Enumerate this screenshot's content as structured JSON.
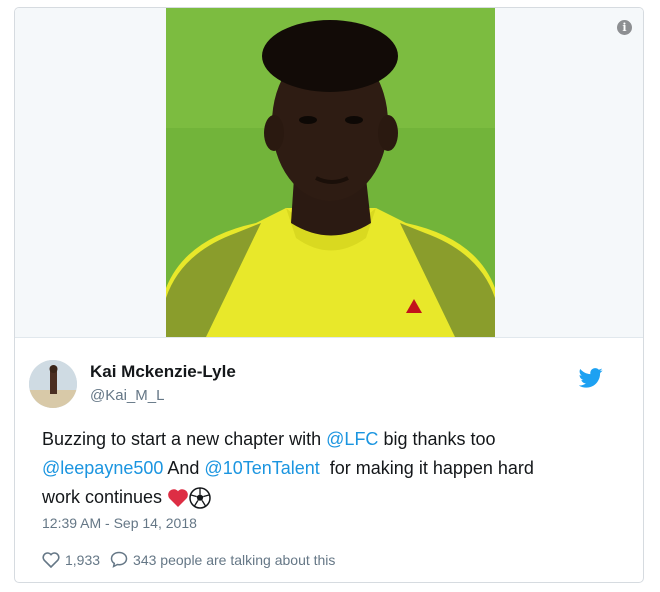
{
  "media": {
    "info_icon": "i",
    "icon": "info-icon"
  },
  "author": {
    "name": "Kai Mckenzie-Lyle",
    "handle": "@Kai_M_L",
    "brand_icon": "twitter-bird-icon",
    "brand_color": "#1da1f2"
  },
  "tweet": {
    "part1": "Buzzing to start a new chapter with ",
    "mention1": "@LFC",
    "part2": " big thanks too",
    "mention2": "@leepayne500",
    "part3": " And ",
    "mention3": "@10TenTalent",
    "part4": "  for making it happen hard",
    "part5": "work continues",
    "emojis": [
      "red-heart-icon",
      "soccer-ball-icon"
    ],
    "link_color": "#1b95e0"
  },
  "timestamp": "12:39 AM - Sep 14, 2018",
  "stats": {
    "likes": "1,933",
    "replies_text": "343 people are talking about this"
  }
}
